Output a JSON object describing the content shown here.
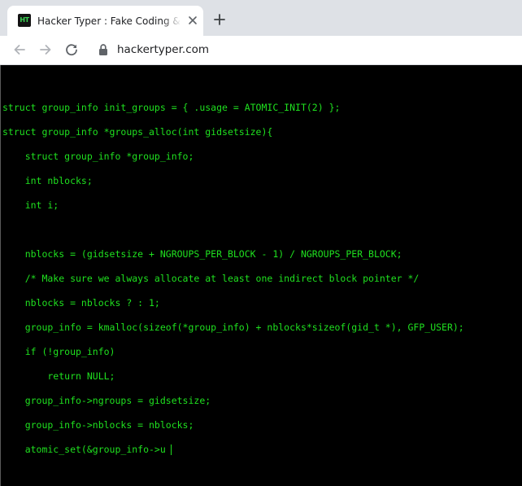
{
  "tab": {
    "title": "Hacker Typer : Fake Coding & Hacker Simulator",
    "favicon_text": "HT",
    "favicon_color": "#39d353"
  },
  "toolbar": {
    "url": "hackertyper.com",
    "back_icon": "arrow-left-icon",
    "forward_icon": "arrow-right-icon",
    "reload_icon": "reload-icon",
    "lock_icon": "lock-icon"
  },
  "code": {
    "text_color": "#1fe11f",
    "background": "#000000",
    "lines": [
      "struct group_info init_groups = { .usage = ATOMIC_INIT(2) };",
      "struct group_info *groups_alloc(int gidsetsize){",
      "    struct group_info *group_info;",
      "    int nblocks;",
      "    int i;",
      "",
      "    nblocks = (gidsetsize + NGROUPS_PER_BLOCK - 1) / NGROUPS_PER_BLOCK;",
      "    /* Make sure we always allocate at least one indirect block pointer */",
      "    nblocks = nblocks ? : 1;",
      "    group_info = kmalloc(sizeof(*group_info) + nblocks*sizeof(gid_t *), GFP_USER);",
      "    if (!group_info)",
      "        return NULL;",
      "    group_info->ngroups = gidsetsize;",
      "    group_info->nblocks = nblocks;",
      "    atomic_set(&group_info->u"
    ]
  }
}
